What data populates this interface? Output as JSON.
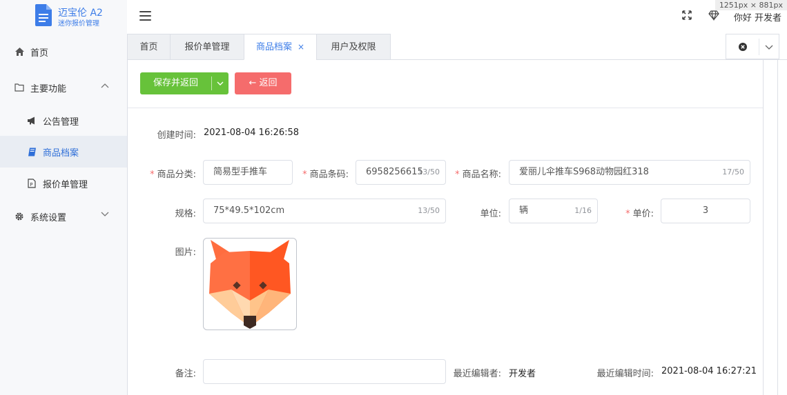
{
  "app": {
    "title": "迈宝伦 A2",
    "subtitle": "迷你报价管理"
  },
  "size_badge": "1251px × 881px",
  "header": {
    "greeting": "你好 开发者"
  },
  "sidebar": {
    "items": [
      {
        "label": "首页",
        "icon": "home-icon"
      },
      {
        "label": "主要功能",
        "icon": "folder-icon",
        "expanded": true
      },
      {
        "label": "公告管理",
        "icon": "megaphone-icon"
      },
      {
        "label": "商品档案",
        "icon": "book-icon",
        "active": true
      },
      {
        "label": "报价单管理",
        "icon": "document-icon"
      },
      {
        "label": "系统设置",
        "icon": "gear-icon",
        "expanded": false
      }
    ]
  },
  "tabs": [
    {
      "label": "首页"
    },
    {
      "label": "报价单管理"
    },
    {
      "label": "商品档案",
      "active": true,
      "close": "×"
    },
    {
      "label": "用户及权限"
    }
  ],
  "toolbar": {
    "save_label": "保存并返回",
    "back_label": "← 返回"
  },
  "form": {
    "created_label": "创建时间:",
    "created_value": "2021-08-04 16:26:58",
    "category_label": "商品分类:",
    "category_value": "简易型手推车",
    "barcode_label": "商品条码:",
    "barcode_value": "6958256615",
    "barcode_count": "13/50",
    "name_label": "商品名称:",
    "name_value": "爱丽儿伞推车S968动物园红318",
    "name_count": "17/50",
    "spec_label": "规格:",
    "spec_value": "75*49.5*102cm",
    "spec_count": "13/50",
    "unit_label": "单位:",
    "unit_value": "辆",
    "unit_count": "1/16",
    "price_label": "单价:",
    "price_value": "3",
    "image_label": "图片:",
    "remark_label": "备注:",
    "remark_value": "",
    "editor_label": "最近编辑者:",
    "editor_value": "开发者",
    "edit_time_label": "最近编辑时间:",
    "edit_time_value": "2021-08-04 16:27:21",
    "required_mark": "*"
  },
  "colors": {
    "primary": "#3d7de8",
    "success": "#67c23a",
    "danger": "#f56c6c"
  }
}
